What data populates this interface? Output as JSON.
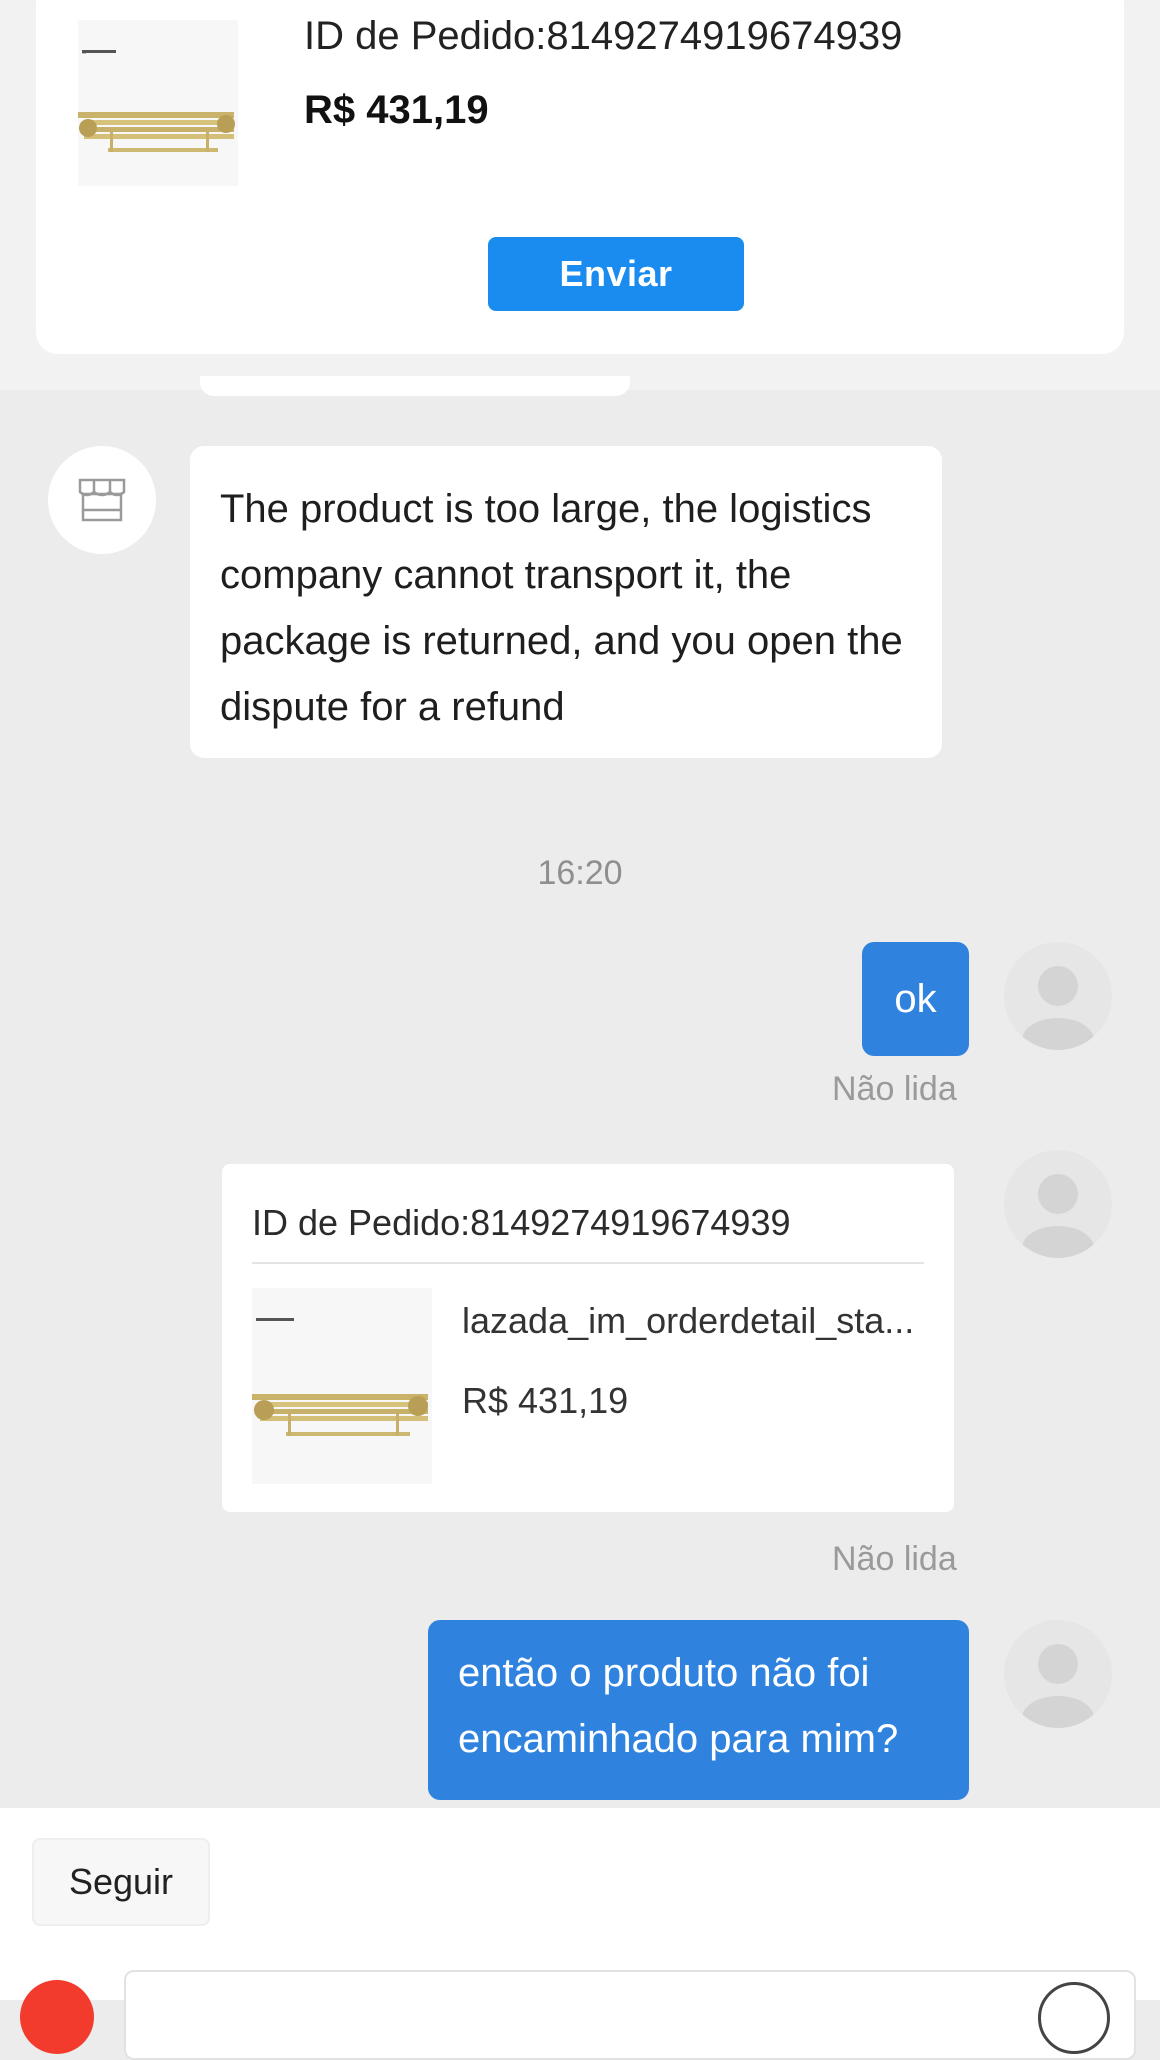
{
  "pinned_order": {
    "order_id": "ID de Pedido:8149274919674939",
    "price": "R$ 431,19",
    "send_label": "Enviar"
  },
  "messages": {
    "incoming": {
      "text": "The product is too large, the logistics company cannot transport it, the package is returned, and you open the dispute for a refund"
    },
    "timestamp": "16:20",
    "ok_message": {
      "text": "ok",
      "status": "Não lida"
    },
    "order_card": {
      "order_id": "ID de Pedido:8149274919674939",
      "product_name": "lazada_im_orderdetail_sta...",
      "price": "R$ 431,19",
      "status": "Não lida"
    },
    "outgoing": {
      "text": "então o produto não foi encaminhado para mim?"
    }
  },
  "bottom_bar": {
    "follow_label": "Seguir"
  },
  "icons": {
    "shop": "store-icon",
    "user": "user-avatar-icon",
    "plus": "plus-icon",
    "emoji": "emoji-icon"
  },
  "colors": {
    "accent_blue": "#1a8cf0",
    "bubble_blue": "#2f83de",
    "background": "#ececec",
    "plus_red": "#f23b2c"
  }
}
